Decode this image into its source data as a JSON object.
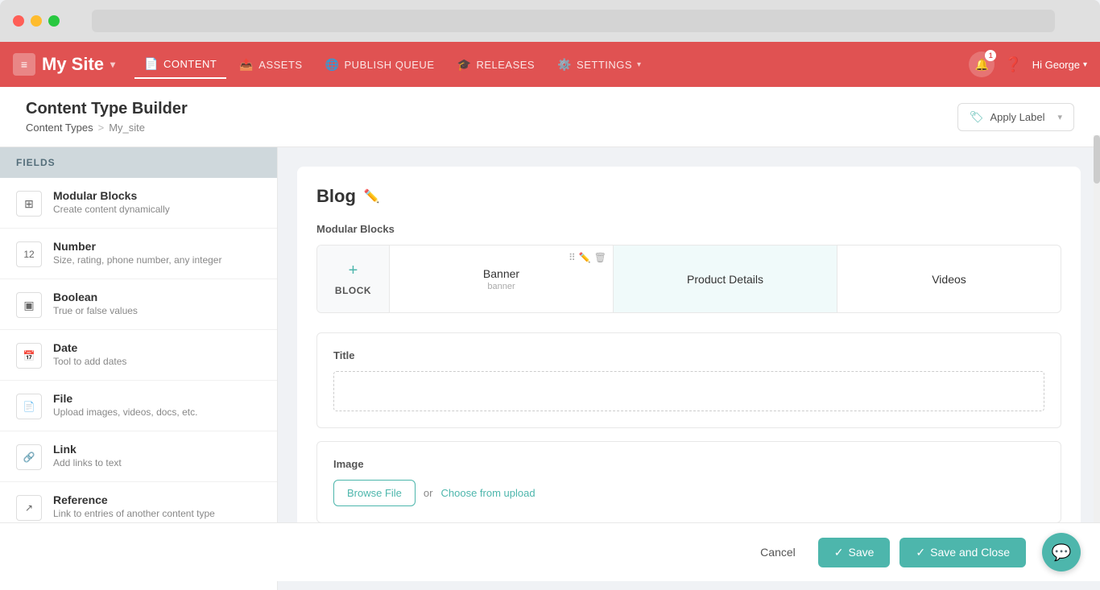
{
  "window": {
    "traffic": [
      "red",
      "yellow",
      "green"
    ]
  },
  "nav": {
    "logo": "My Site",
    "chevron": "▾",
    "items": [
      {
        "label": "CONTENT",
        "icon": "📄",
        "active": true
      },
      {
        "label": "ASSETS",
        "icon": "📤"
      },
      {
        "label": "PUBLISH QUEUE",
        "icon": "🌐"
      },
      {
        "label": "RELEASES",
        "icon": "🎓"
      },
      {
        "label": "SETTINGS",
        "icon": "⚙️",
        "hasChevron": true
      }
    ],
    "bell_count": "1",
    "user": "Hi  George",
    "user_chevron": "▾"
  },
  "page": {
    "title": "Content Type Builder",
    "breadcrumb": {
      "parent": "Content Types",
      "separator": ">",
      "current": "My_site"
    },
    "apply_label": "Apply Label",
    "apply_label_chevron": "▾"
  },
  "sidebar": {
    "header": "FIELDS",
    "items": [
      {
        "name": "Modular Blocks",
        "desc": "Create content dynamically",
        "icon": "⊞"
      },
      {
        "name": "Number",
        "desc": "Size, rating, phone number, any integer",
        "icon": "⊟"
      },
      {
        "name": "Boolean",
        "desc": "True or false values",
        "icon": "▣"
      },
      {
        "name": "Date",
        "desc": "Tool to add dates",
        "icon": "📅"
      },
      {
        "name": "File",
        "desc": "Upload images, videos, docs, etc.",
        "icon": "📄"
      },
      {
        "name": "Link",
        "desc": "Add links to text",
        "icon": "🔗"
      },
      {
        "name": "Reference",
        "desc": "Link to entries of another content type",
        "icon": "↗"
      }
    ]
  },
  "content": {
    "blog_title": "Blog",
    "section_label": "Modular Blocks",
    "blocks": [
      {
        "id": "add",
        "label": "BLOCK",
        "type": "add"
      },
      {
        "id": "banner",
        "label": "Banner",
        "subtitle": "banner",
        "active": false
      },
      {
        "id": "product",
        "label": "Product Details",
        "active": true
      },
      {
        "id": "videos",
        "label": "Videos",
        "active": false
      }
    ],
    "fields": [
      {
        "id": "title",
        "label": "Title",
        "type": "text"
      },
      {
        "id": "image",
        "label": "Image",
        "type": "file",
        "browse_label": "Browse File",
        "or_text": "or",
        "choose_label": "Choose from upload"
      }
    ]
  },
  "footer": {
    "cancel_label": "Cancel",
    "save_label": "Save",
    "save_close_label": "Save and Close",
    "check_icon": "✓"
  }
}
